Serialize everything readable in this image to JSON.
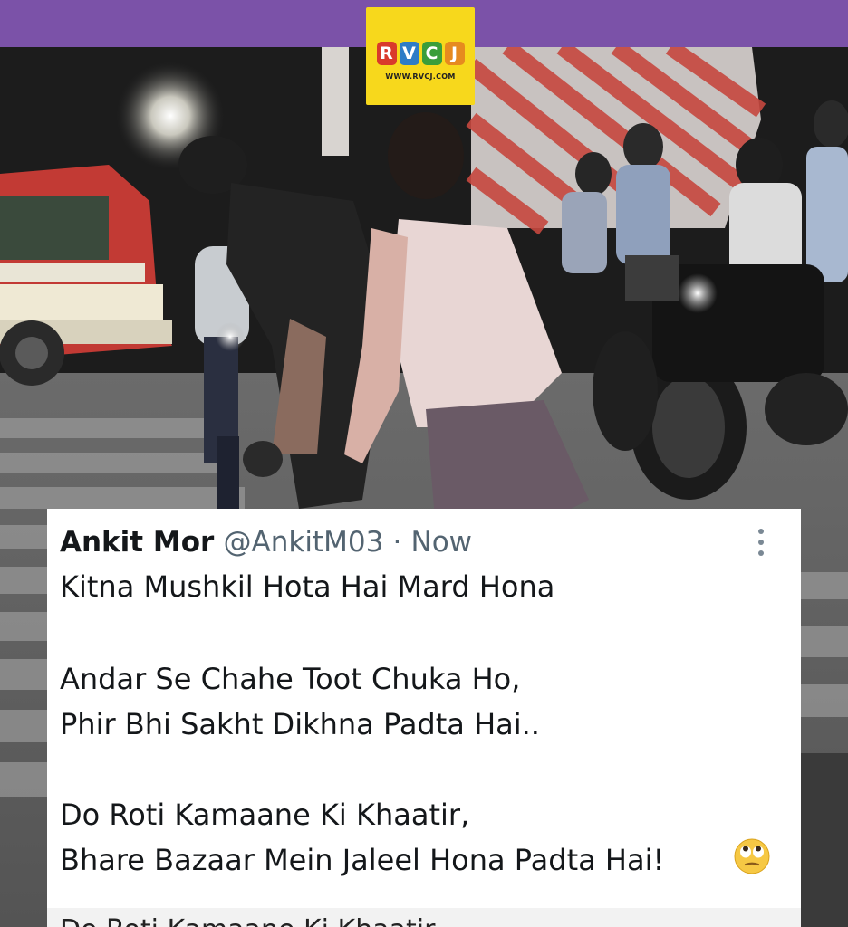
{
  "colors": {
    "top_bar": "#7b52a8",
    "logo_background": "#f7d81c",
    "logo_letter_colors": [
      "#d93a2b",
      "#2e7cc6",
      "#3a9d3a",
      "#e68a1f"
    ],
    "card_background": "#ffffff",
    "name_color": "#14171a",
    "meta_color": "#536471"
  },
  "logo": {
    "letters": [
      "R",
      "V",
      "C",
      "J"
    ],
    "url": "WWW.RVCJ.COM"
  },
  "tweet": {
    "author_name": "Ankit Mor",
    "handle": "@AnkitM03",
    "separator": "·",
    "time": "Now",
    "lines": [
      "Kitna Mushkil Hota Hai Mard Hona",
      "Andar Se Chahe Toot Chuka Ho,",
      "Phir Bhi Sakht Dikhna Padta Hai..",
      "Do Roti Kamaane Ki Khaatir,",
      "Bhare Bazaar Mein Jaleel Hona Padta Hai!"
    ],
    "emoji": "face-with-rolling-eyes"
  },
  "overflow_text": "Do Roti Kamaane Ki Khaatir"
}
